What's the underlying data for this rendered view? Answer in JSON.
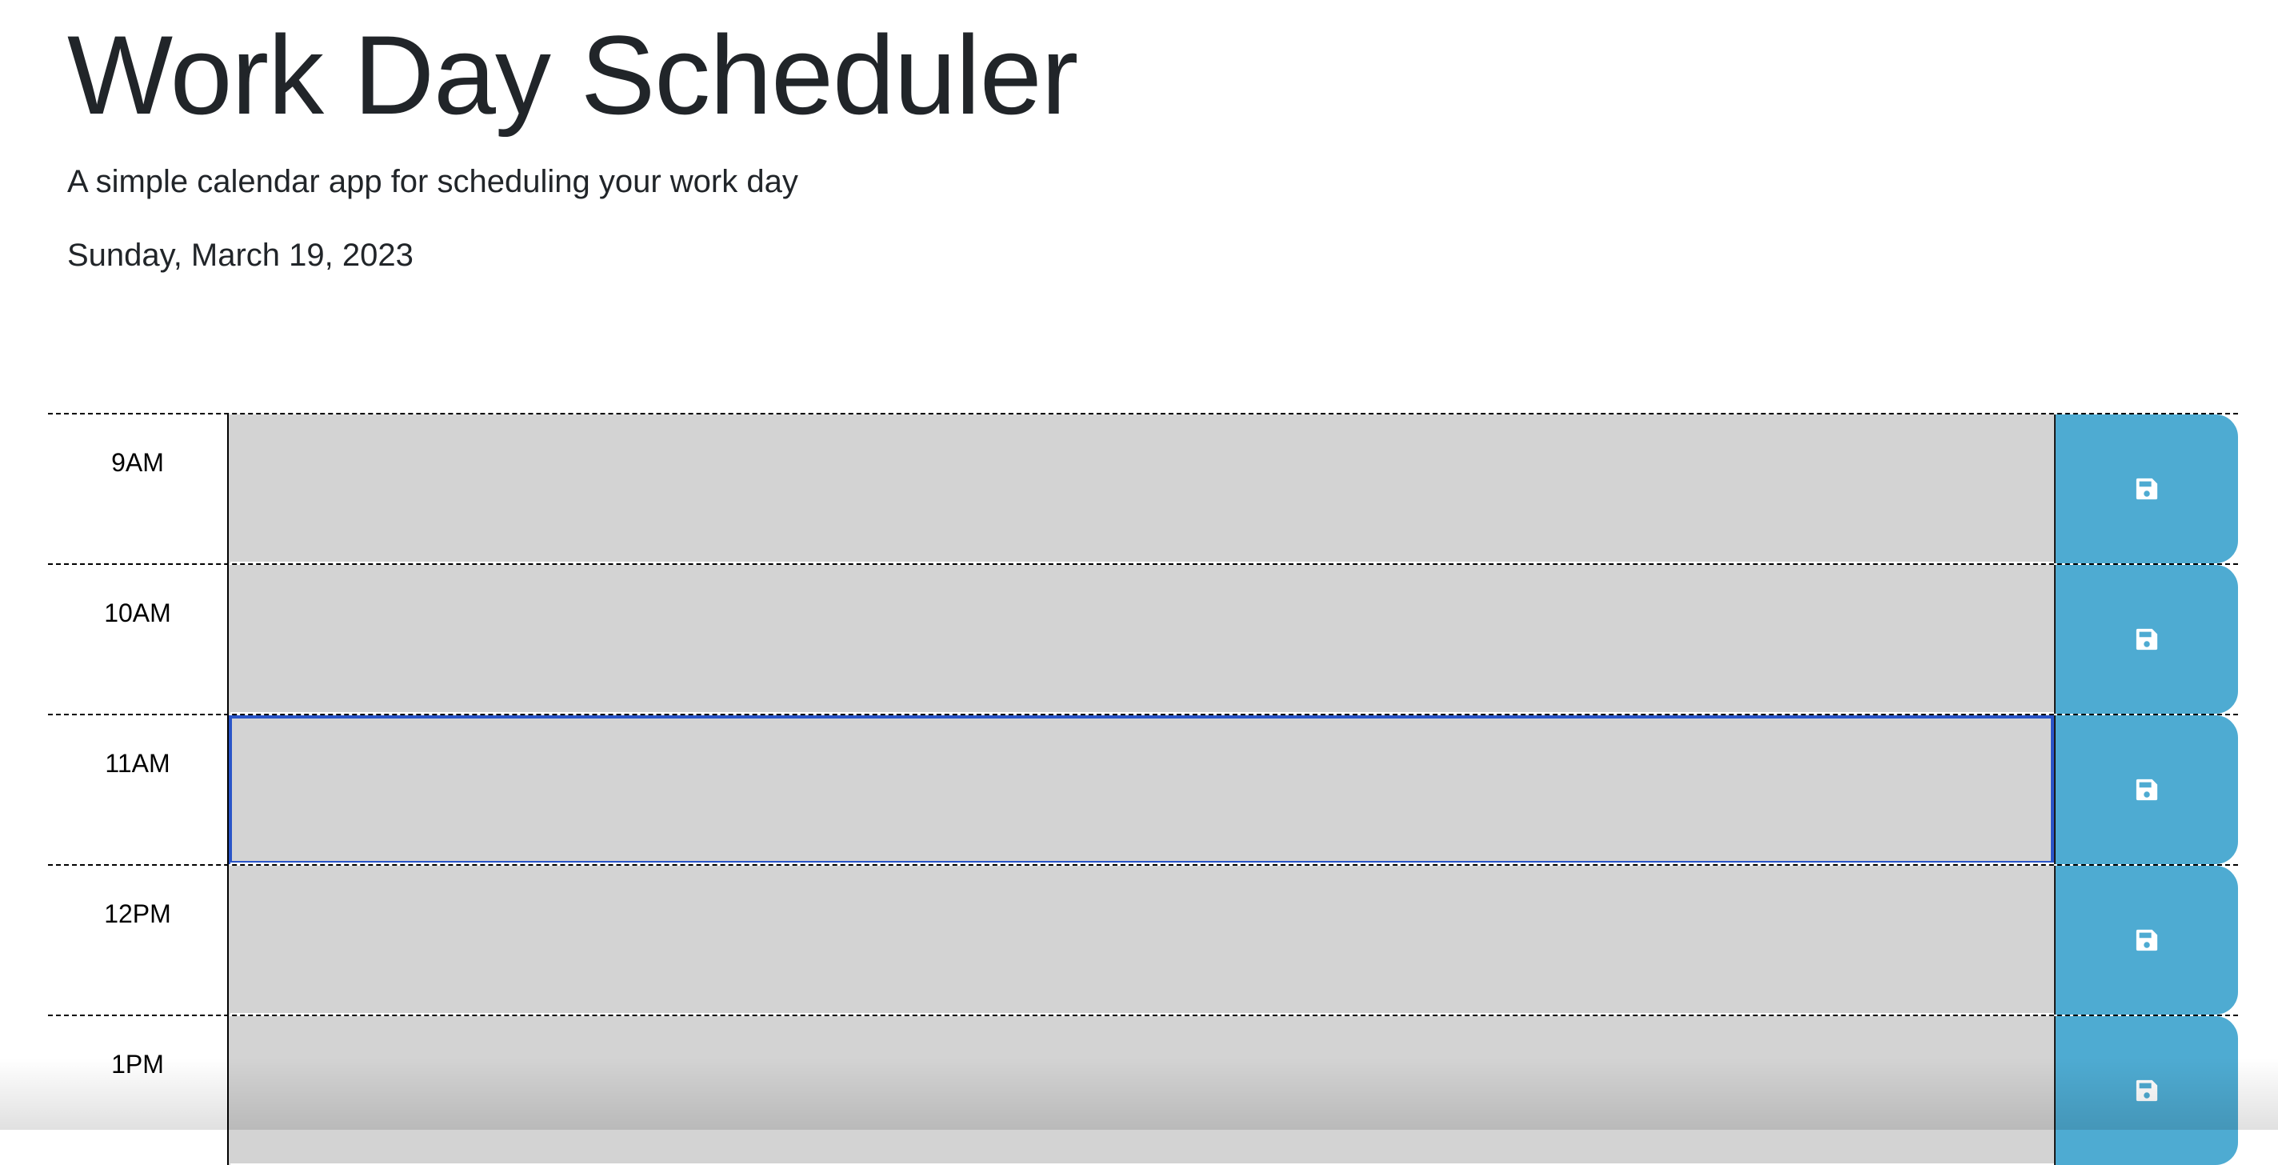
{
  "header": {
    "title": "Work Day Scheduler",
    "subtitle": "A simple calendar app for scheduling your work day",
    "current_day": "Sunday, March 19, 2023"
  },
  "colors": {
    "past": "#d3d3d3",
    "save_button": "#4eabd2",
    "focus_ring": "#2a55c8"
  },
  "time_blocks": [
    {
      "hour": "9AM",
      "description": "",
      "icon": "floppy-disk-icon"
    },
    {
      "hour": "10AM",
      "description": "",
      "icon": "floppy-disk-icon"
    },
    {
      "hour": "11AM",
      "description": "",
      "icon": "floppy-disk-icon",
      "focused": true
    },
    {
      "hour": "12PM",
      "description": "",
      "icon": "floppy-disk-icon"
    },
    {
      "hour": "1PM",
      "description": "",
      "icon": "floppy-disk-icon"
    }
  ]
}
